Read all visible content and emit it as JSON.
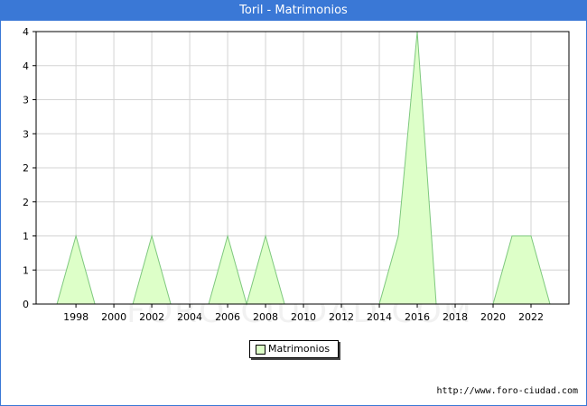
{
  "header": {
    "title": "Toril - Matrimonios"
  },
  "footer": {
    "source": "http://www.foro-ciudad.com"
  },
  "watermark": "FORO-CIUDAD.COM",
  "colors": {
    "title_bar": "#3a78d6",
    "series_fill": "#ddffc8",
    "series_line": "#7ec87e",
    "grid": "#d3d3d3"
  },
  "chart_data": {
    "type": "area",
    "title": "Toril - Matrimonios",
    "xlabel": "",
    "ylabel": "",
    "x": [
      1997,
      1998,
      1999,
      2000,
      2001,
      2002,
      2003,
      2004,
      2005,
      2006,
      2007,
      2008,
      2009,
      2010,
      2011,
      2012,
      2013,
      2014,
      2015,
      2016,
      2017,
      2018,
      2019,
      2020,
      2021,
      2022,
      2023
    ],
    "series": [
      {
        "name": "Matrimonios",
        "values": [
          0,
          1,
          0,
          0,
          0,
          1,
          0,
          0,
          0,
          1,
          0,
          1,
          0,
          0,
          0,
          0,
          0,
          0,
          1,
          4,
          0,
          0,
          0,
          0,
          1,
          1,
          0
        ]
      }
    ],
    "xticks": [
      1998,
      2000,
      2002,
      2004,
      2006,
      2008,
      2010,
      2012,
      2014,
      2016,
      2018,
      2020,
      2022
    ],
    "yticks": [
      0,
      0.5,
      1,
      1.5,
      2,
      2.5,
      3,
      3.5,
      4
    ],
    "ytick_labels": [
      "0",
      "1",
      "1",
      "2",
      "2",
      "3",
      "3",
      "4",
      "4"
    ],
    "xlim": [
      1995.9,
      2024
    ],
    "ylim": [
      0,
      4
    ],
    "grid": true,
    "legend": "bottom-center"
  }
}
